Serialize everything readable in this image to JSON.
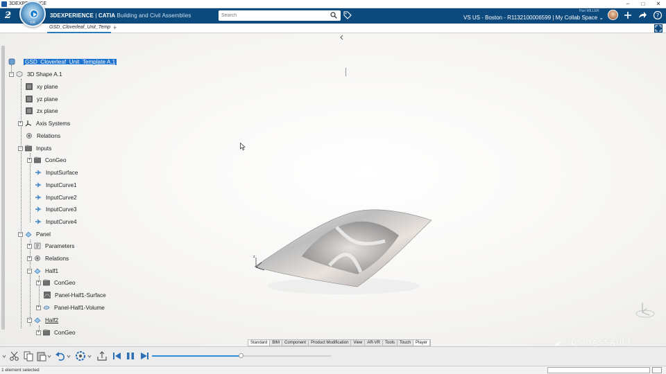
{
  "window": {
    "title": "3DEXPERIENCE",
    "controls": [
      "–",
      "□",
      "✕"
    ]
  },
  "topbar": {
    "compass_label": "V,R",
    "brand_main": "3DEXPERIENCE",
    "brand_sep": " | ",
    "brand_app": "CATIA",
    "brand_sub": "Building and Civil Assemblies",
    "search_placeholder": "Search",
    "user_name": "Huri MILLER",
    "context": "VS US - Boston - R1132100006599 | My Collab Space ⌄"
  },
  "tabs": {
    "active_label": "GSD_Cloverleaf_Unit_Temp",
    "add_label": "+"
  },
  "tree": {
    "root": "GSD_Cloverleaf_Unit_Template A.1",
    "shape": "3D Shape A.1",
    "xy": "xy plane",
    "yz": "yz plane",
    "zx": "zx plane",
    "axis": "Axis Systems",
    "relations": "Relations",
    "inputs": "Inputs",
    "congeo1": "ConGeo",
    "inputsurface": "InputSurface",
    "inputcurve1": "InputCurve1",
    "inputcurve2": "InputCurve2",
    "inputcurve3": "InputCurve3",
    "inputcurve4": "InputCurve4",
    "panel": "Panel",
    "parameters": "Parameters",
    "relations2": "Relations",
    "half1": "Half1",
    "congeo2": "ConGeo",
    "half1surface": "Panel-Half1-Surface",
    "half1volume": "Panel-Half1-Volume",
    "half2": "Half2",
    "congeo3": "ConGeo"
  },
  "action_tabs": [
    "Standard",
    "BIM",
    "Component",
    "Product Modification",
    "View",
    "AR-VR",
    "Tools",
    "Touch",
    "Player"
  ],
  "active_action_tab": "Player",
  "playback": {
    "progress": 0.5
  },
  "watermark": "3DS DASSAULT\nSYSTEMES",
  "status": {
    "text": "1 element selected"
  },
  "colors": {
    "topbar": "#0c4a7e",
    "selection": "#1e73cf",
    "progress": "#2d8fd5"
  }
}
